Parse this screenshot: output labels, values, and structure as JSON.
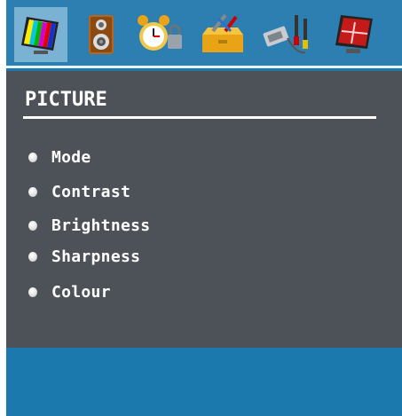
{
  "menu": {
    "title": "PICTURE",
    "items": [
      {
        "label": "Mode"
      },
      {
        "label": "Contrast"
      },
      {
        "label": "Brightness"
      },
      {
        "label": "Sharpness"
      },
      {
        "label": "Colour"
      }
    ]
  },
  "tabs": [
    {
      "icon": "picture-monitor-icon",
      "active": true
    },
    {
      "icon": "speaker-icon",
      "active": false
    },
    {
      "icon": "alarm-clock-lock-icon",
      "active": false
    },
    {
      "icon": "toolbox-icon",
      "active": false
    },
    {
      "icon": "cables-plugs-icon",
      "active": false
    },
    {
      "icon": "red-cross-monitor-icon",
      "active": false
    }
  ],
  "colors": {
    "header": "#2d7fb2",
    "panel": "#4d5258",
    "footer": "#1c79ae",
    "active_tab": "#7ab2d4",
    "text": "#ffffff"
  }
}
